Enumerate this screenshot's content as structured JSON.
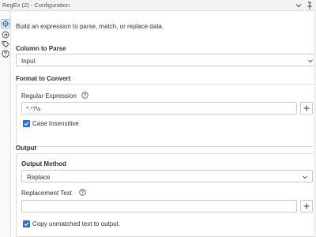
{
  "window": {
    "title": "RegEx (2) - Configuration",
    "chevron_icon": "chevron-down-icon",
    "pin_icon": "pin-icon"
  },
  "sidebar": {
    "items": [
      {
        "icon": "gear-icon",
        "active": true
      },
      {
        "icon": "workflow-icon",
        "active": false
      },
      {
        "icon": "tag-icon",
        "active": false
      },
      {
        "icon": "help-icon",
        "active": false
      }
    ]
  },
  "main": {
    "description": "Build an expression to parse, match, or replace data.",
    "column_to_parse": {
      "label": "Column to Parse",
      "value": "Input"
    },
    "format": {
      "label": "Format to Convert",
      "regex_label": "Regular Expression",
      "regex_value": "^.*?\\s",
      "case_insensitive_label": "Case Insensitive",
      "case_insensitive_checked": true
    },
    "output": {
      "label": "Output",
      "method_label": "Output Method",
      "method_value": "Replace",
      "replacement_label": "Replacement Text",
      "replacement_value": "",
      "copy_unmatched_label": "Copy unmatched text to output.",
      "copy_unmatched_checked": true
    }
  },
  "colors": {
    "accent": "#2d6dd2",
    "border": "#c8ccd2",
    "panel_border": "#d8dbe0"
  }
}
